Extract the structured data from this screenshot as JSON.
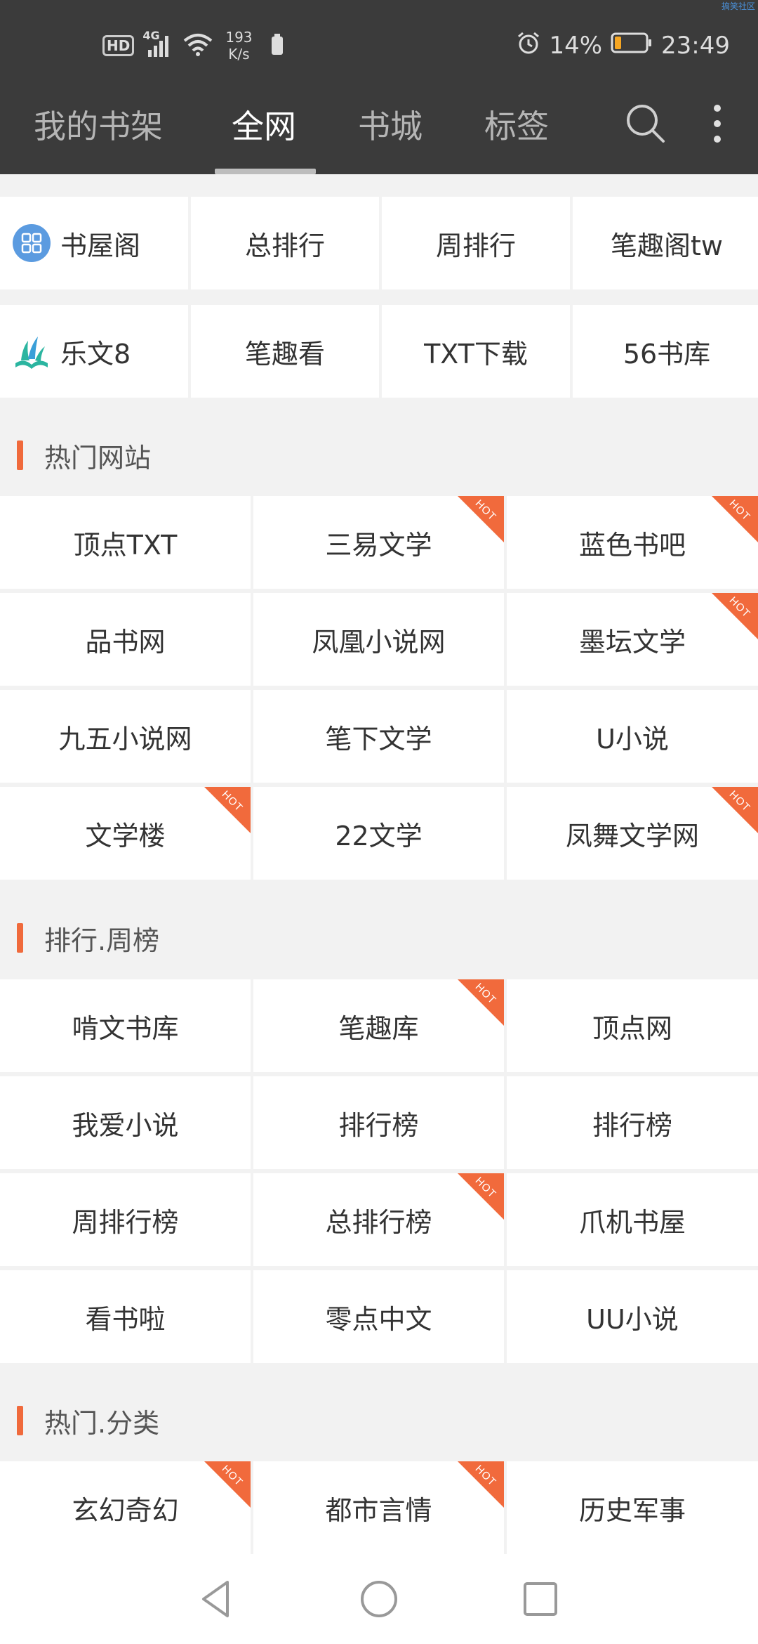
{
  "status_bar": {
    "hd": "HD",
    "network_type": "4G",
    "speed_value": "193",
    "speed_unit": "K/s",
    "battery_percent": "14%",
    "time": "23:49",
    "corner_tag": "搞笑社区"
  },
  "tabs": [
    {
      "label": "我的书架"
    },
    {
      "label": "全网"
    },
    {
      "label": "书城"
    },
    {
      "label": "标签"
    }
  ],
  "active_tab": "全网",
  "quick_links": [
    {
      "label": "书屋阁",
      "logo": "grid-logo-icon"
    },
    {
      "label": "总排行"
    },
    {
      "label": "周排行"
    },
    {
      "label": "笔趣阁tw"
    },
    {
      "label": "乐文8",
      "logo": "book-logo-icon"
    },
    {
      "label": "笔趣看"
    },
    {
      "label": "TXT下载"
    },
    {
      "label": "56书库"
    }
  ],
  "hot_badge": "HOT",
  "sections": [
    {
      "title": "热门网站",
      "items": [
        {
          "label": "顶点TXT",
          "hot": false
        },
        {
          "label": "三易文学",
          "hot": true
        },
        {
          "label": "蓝色书吧",
          "hot": true
        },
        {
          "label": "品书网",
          "hot": false
        },
        {
          "label": "凤凰小说网",
          "hot": false
        },
        {
          "label": "墨坛文学",
          "hot": true
        },
        {
          "label": "九五小说网",
          "hot": false
        },
        {
          "label": "笔下文学",
          "hot": false
        },
        {
          "label": "U小说",
          "hot": false
        },
        {
          "label": "文学楼",
          "hot": true
        },
        {
          "label": "22文学",
          "hot": false
        },
        {
          "label": "凤舞文学网",
          "hot": true
        }
      ]
    },
    {
      "title": "排行.周榜",
      "items": [
        {
          "label": "啃文书库",
          "hot": false
        },
        {
          "label": "笔趣库",
          "hot": true
        },
        {
          "label": "顶点网",
          "hot": false
        },
        {
          "label": "我爱小说",
          "hot": false
        },
        {
          "label": "排行榜",
          "hot": false
        },
        {
          "label": "排行榜",
          "hot": false
        },
        {
          "label": "周排行榜",
          "hot": false
        },
        {
          "label": "总排行榜",
          "hot": true
        },
        {
          "label": "爪机书屋",
          "hot": false
        },
        {
          "label": "看书啦",
          "hot": false
        },
        {
          "label": "零点中文",
          "hot": false
        },
        {
          "label": "UU小说",
          "hot": false
        }
      ]
    },
    {
      "title": "热门.分类",
      "items": [
        {
          "label": "玄幻奇幻",
          "hot": true
        },
        {
          "label": "都市言情",
          "hot": true
        },
        {
          "label": "历史军事",
          "hot": false
        }
      ]
    }
  ],
  "icons": {
    "search": "search-icon",
    "more": "more-vertical-icon",
    "nav_back": "back-triangle-icon",
    "nav_home": "home-circle-icon",
    "nav_recent": "recent-square-icon"
  },
  "colors": {
    "topbar": "#3b3b3b",
    "accent": "#f06a3c",
    "background": "#f2f2f2"
  }
}
